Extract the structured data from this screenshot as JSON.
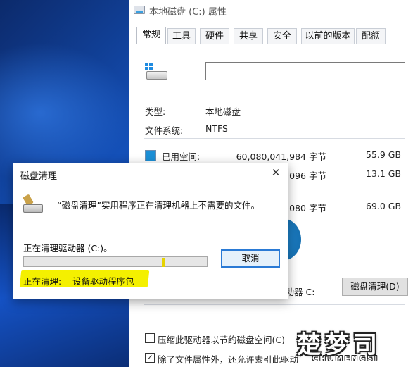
{
  "properties_window": {
    "title": "本地磁盘 (C:) 属性",
    "tabs": [
      "常规",
      "工具",
      "硬件",
      "共享",
      "安全",
      "以前的版本",
      "配额"
    ],
    "active_tab": "常规",
    "name_value": "",
    "type_label": "类型:",
    "type_value": "本地磁盘",
    "fs_label": "文件系统:",
    "fs_value": "NTFS",
    "used_label": "已用空间:",
    "used_bytes": "60,080,041,984 字节",
    "used_gb": "55.9 GB",
    "free_bytes": "096 字节",
    "free_gb": "13.1 GB",
    "capacity_bytes": "080 字节",
    "capacity_gb": "69.0 GB",
    "drive_label": "驱动器 C:",
    "cleanup_button": "磁盘清理(D)",
    "compress_option": "压缩此驱动器以节约磁盘空间(C)",
    "compress_checked": false,
    "index_option": "除了文件属性外，还允许索引此驱动",
    "index_checked": true,
    "colors": {
      "used": "#1b8fd6",
      "free": "#e6e6e6"
    }
  },
  "cleanup_dialog": {
    "title": "磁盘清理",
    "close_glyph": "✕",
    "message": "“磁盘清理”实用程序正在清理机器上不需要的文件。",
    "status": "正在清理驱动器 (C:)。",
    "progress": 0.77,
    "cancel_button": "取消",
    "cleaning_label": "正在清理:",
    "cleaning_item": "设备驱动程序包",
    "highlight_color": "#f4f000"
  },
  "watermark": {
    "glyphs": "楚梦司",
    "subtitle": "CHUMENGSI"
  }
}
